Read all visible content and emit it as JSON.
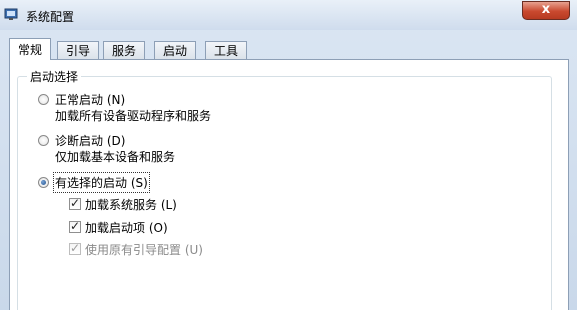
{
  "window": {
    "title": "系统配置",
    "close_label": "x"
  },
  "tabs": [
    "常规",
    "引导",
    "服务",
    "启动",
    "工具"
  ],
  "startup_group": {
    "legend": "启动选择",
    "normal": {
      "label": "正常启动 (N)",
      "desc": "加载所有设备驱动程序和服务",
      "selected": false
    },
    "diagnostic": {
      "label": "诊断启动 (D)",
      "desc": "仅加载基本设备和服务",
      "selected": false
    },
    "selective": {
      "label": "有选择的启动 (S)",
      "selected": true,
      "options": [
        {
          "label": "加载系统服务 (L)",
          "checked": true,
          "enabled": true
        },
        {
          "label": "加载启动项 (O)",
          "checked": true,
          "enabled": true
        },
        {
          "label": "使用原有引导配置 (U)",
          "checked": true,
          "enabled": false
        }
      ]
    }
  }
}
